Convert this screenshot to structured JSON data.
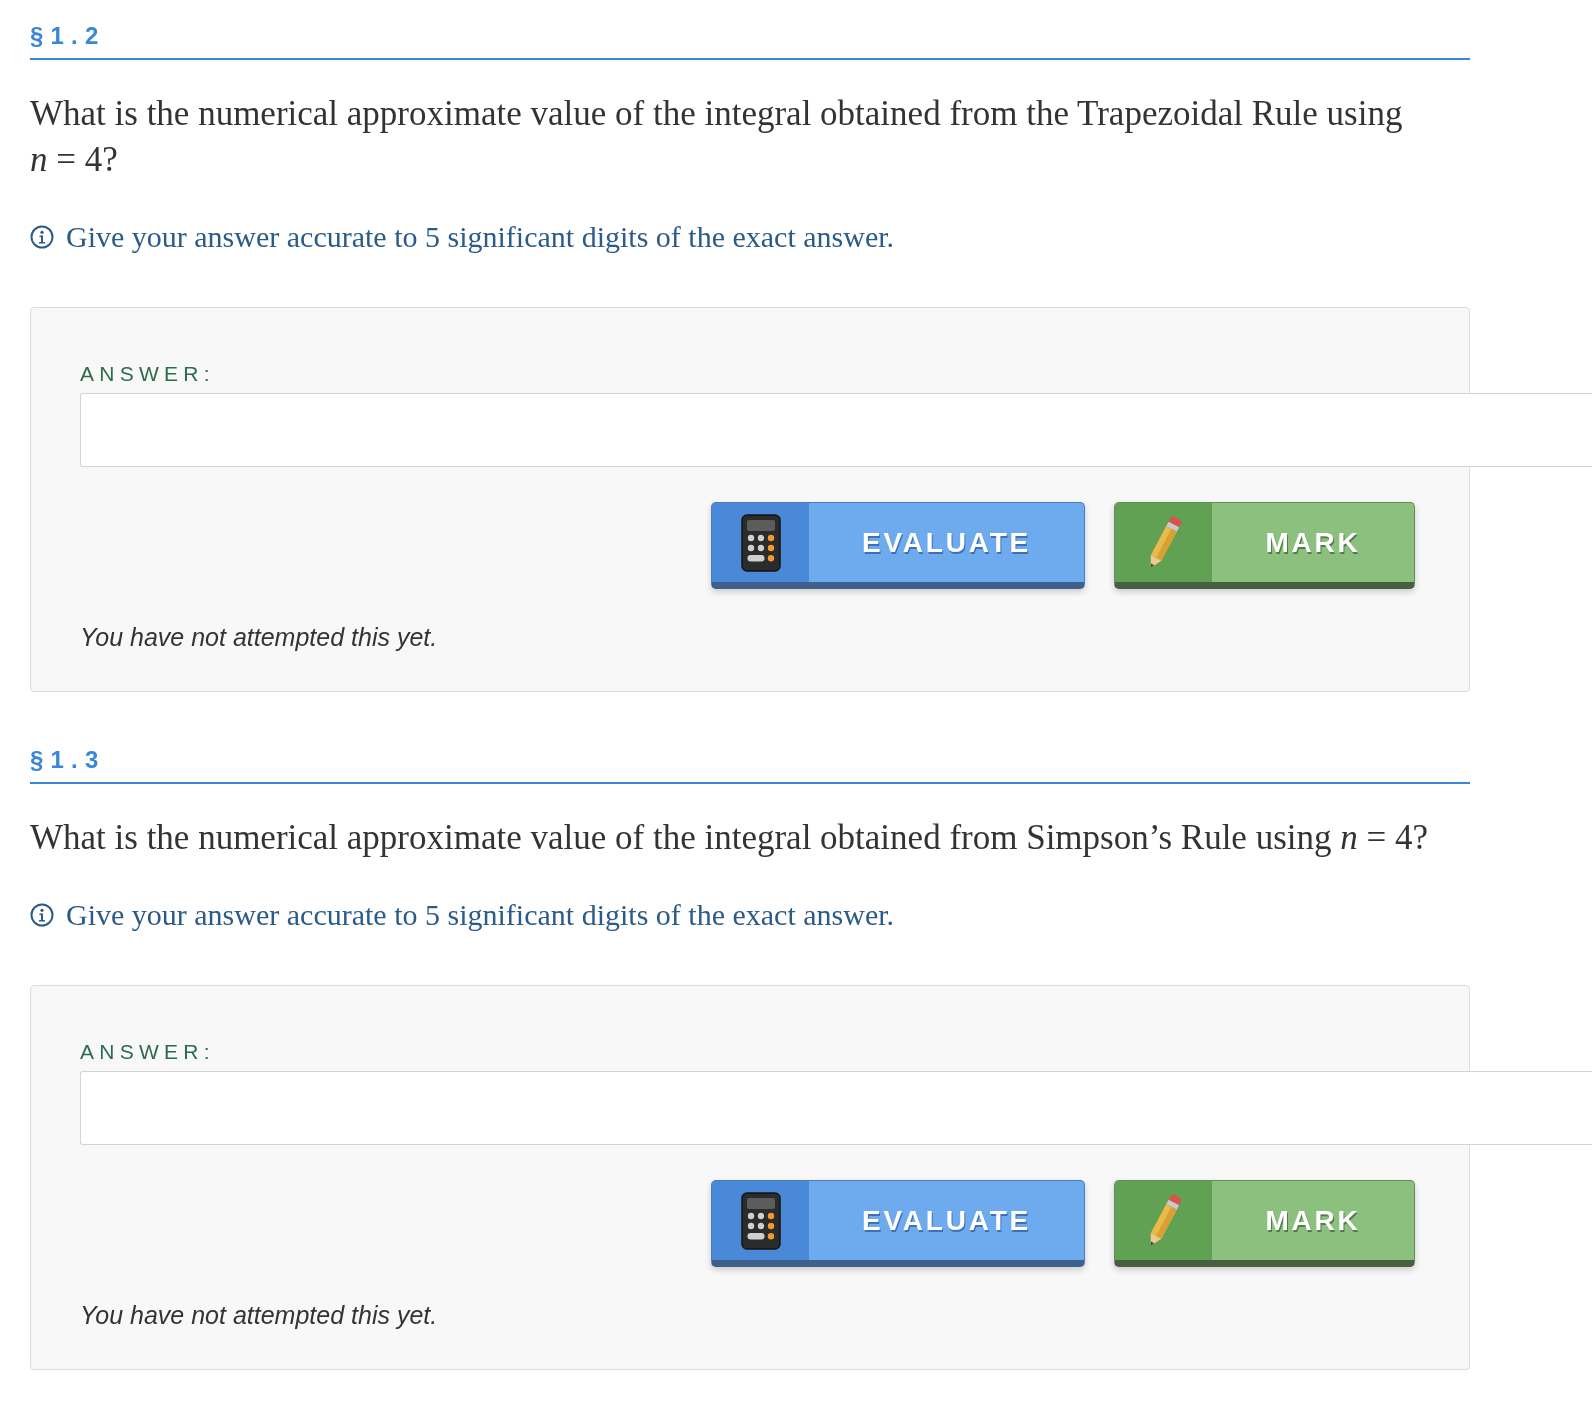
{
  "sections": [
    {
      "heading": "§1.2",
      "question": "What is the numerical approximate value of the integral obtained from the Trapezoidal Rule using *n* = 4?",
      "hint": "Give your answer accurate to 5 significant digits of the exact answer.",
      "answer": {
        "label": "ANSWER:",
        "buttons": [
          {
            "kind": "evaluate",
            "label": "EVALUATE"
          },
          {
            "kind": "mark",
            "label": "MARK"
          }
        ],
        "status": "You have not attempted this yet."
      }
    },
    {
      "heading": "§1.3",
      "question": "What is the numerical approximate value of the integral obtained from Simpson’s Rule using *n* = 4?",
      "hint": "Give your answer accurate to 5 significant digits of the exact answer.",
      "answer": {
        "label": "ANSWER:",
        "buttons": [
          {
            "kind": "evaluate",
            "label": "EVALUATE"
          },
          {
            "kind": "mark",
            "label": "MARK"
          }
        ],
        "status": "You have not attempted this yet."
      }
    }
  ]
}
